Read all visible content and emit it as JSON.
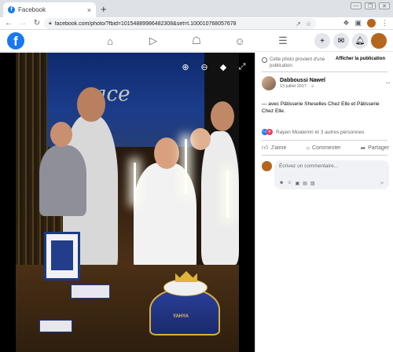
{
  "browser": {
    "tab_title": "Facebook",
    "tab_close": "×",
    "new_tab": "+",
    "back": "←",
    "forward": "→",
    "reload": "C",
    "url": "facebook.com/photo/?fbid=10154889986482308&set=t.100010768057678",
    "window_controls": [
      "—",
      "❐",
      "✕"
    ]
  },
  "facebook": {
    "logo": "f",
    "nav_icons": [
      "home-icon",
      "watch-icon",
      "marketplace-icon",
      "groups-icon",
      "menu-icon"
    ]
  },
  "photo": {
    "banner_text": "ace",
    "cake_label": "YAHYA"
  },
  "panel": {
    "notice_text": "Cette photo provient d'une publication.",
    "notice_button": "Afficher la publication",
    "author_name": "Dabboussi Nawel",
    "post_date": "13 juillet 2017 · ",
    "more": "···",
    "caption": "— avec Pâtisserie Sheselles Chez Elle et Pâtisserie Chez Elle.",
    "reactions_text": "Rayen Moatemri et 3 autres personnes",
    "like_label": "J'aime",
    "comment_label": "Commenter",
    "share_label": "Partager",
    "comment_placeholder": "Écrivez un commentaire..."
  }
}
